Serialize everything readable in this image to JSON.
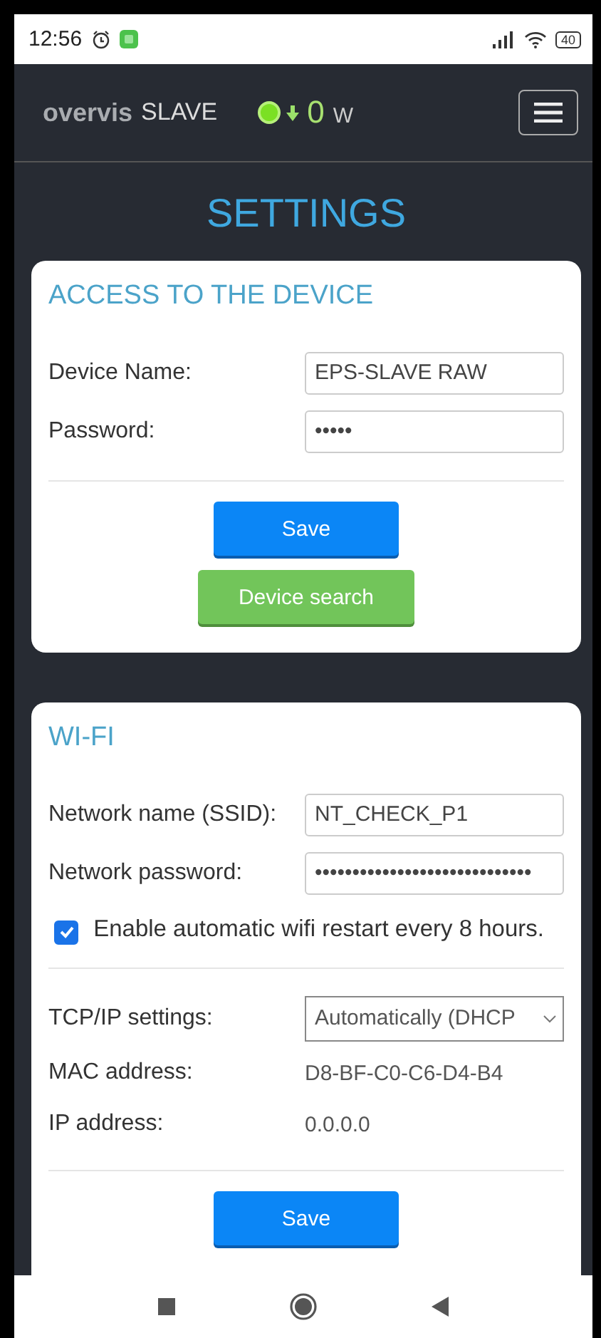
{
  "status_bar": {
    "time": "12:56",
    "battery": "40"
  },
  "header": {
    "brand": "overvis",
    "brand_suffix": "SLAVE",
    "online": true,
    "power": "0",
    "power_unit": "W"
  },
  "page_title": "SETTINGS",
  "access_card": {
    "title": "ACCESS TO THE DEVICE",
    "fields": [
      {
        "label": "Device Name:",
        "value": "EPS-SLAVE RAW"
      },
      {
        "label": "Password:",
        "value": "•••••"
      }
    ],
    "save_button": "Save",
    "search_button": "Device search"
  },
  "wifi_card": {
    "title": "WI-FI",
    "fields": [
      {
        "label": "Network name (SSID):",
        "value": "NT_CHECK_P1"
      },
      {
        "label": "Network password:",
        "value": "•••••••••••••••••••••••••••••"
      }
    ],
    "auto_restart": {
      "label": "Enable automatic wifi restart every 8 hours.",
      "checked": true
    },
    "tcp_ip": {
      "label": "TCP/IP settings:",
      "value": "Automatically (DHCP"
    },
    "info": [
      {
        "label": "MAC address:",
        "value": "D8-BF-C0-C6-D4-B4"
      },
      {
        "label": "IP address:",
        "value": "0.0.0.0"
      }
    ],
    "save_button": "Save"
  }
}
